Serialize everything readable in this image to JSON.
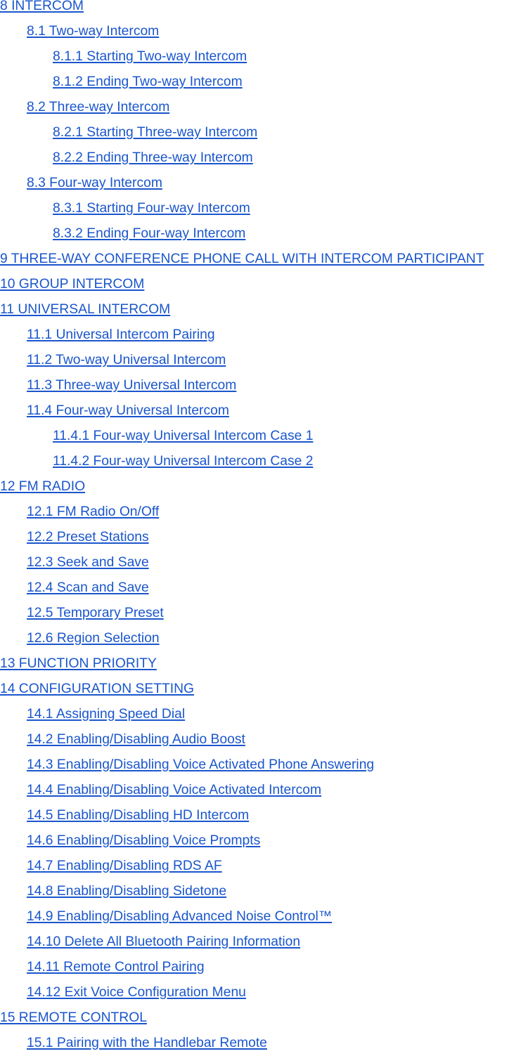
{
  "link_color": "#1a56cc",
  "toc": [
    {
      "level": 1,
      "label": "8 INTERCOM"
    },
    {
      "level": 2,
      "label": "8.1 Two-way Intercom"
    },
    {
      "level": 3,
      "label": "8.1.1 Starting Two-way Intercom"
    },
    {
      "level": 3,
      "label": "8.1.2 Ending Two-way Intercom"
    },
    {
      "level": 2,
      "label": "8.2 Three-way Intercom"
    },
    {
      "level": 3,
      "label": "8.2.1 Starting Three-way Intercom"
    },
    {
      "level": 3,
      "label": "8.2.2 Ending Three-way Intercom"
    },
    {
      "level": 2,
      "label": "8.3 Four-way Intercom"
    },
    {
      "level": 3,
      "label": "8.3.1 Starting Four-way Intercom"
    },
    {
      "level": 3,
      "label": "8.3.2 Ending Four-way Intercom"
    },
    {
      "level": 1,
      "label": "9 THREE-WAY CONFERENCE PHONE CALL WITH INTERCOM PARTICIPANT"
    },
    {
      "level": 1,
      "label": "10 GROUP INTERCOM"
    },
    {
      "level": 1,
      "label": "11 UNIVERSAL INTERCOM"
    },
    {
      "level": 2,
      "label": "11.1 Universal Intercom Pairing"
    },
    {
      "level": 2,
      "label": "11.2 Two-way Universal Intercom"
    },
    {
      "level": 2,
      "label": "11.3 Three-way Universal Intercom"
    },
    {
      "level": 2,
      "label": "11.4 Four-way Universal Intercom"
    },
    {
      "level": 3,
      "label": "11.4.1 Four-way Universal Intercom Case 1"
    },
    {
      "level": 3,
      "label": "11.4.2 Four-way Universal Intercom Case 2"
    },
    {
      "level": 1,
      "label": "12 FM RADIO"
    },
    {
      "level": 2,
      "label": "12.1 FM Radio On/Off"
    },
    {
      "level": 2,
      "label": "12.2 Preset Stations"
    },
    {
      "level": 2,
      "label": "12.3 Seek and Save"
    },
    {
      "level": 2,
      "label": "12.4 Scan and Save"
    },
    {
      "level": 2,
      "label": "12.5 Temporary Preset"
    },
    {
      "level": 2,
      "label": "12.6 Region Selection"
    },
    {
      "level": 1,
      "label": "13 FUNCTION PRIORITY"
    },
    {
      "level": 1,
      "label": "14 CONFIGURATION SETTING"
    },
    {
      "level": 2,
      "label": "14.1 Assigning Speed Dial"
    },
    {
      "level": 2,
      "label": "14.2 Enabling/Disabling Audio Boost"
    },
    {
      "level": 2,
      "label": "14.3 Enabling/Disabling Voice Activated Phone Answering"
    },
    {
      "level": 2,
      "label": "14.4 Enabling/Disabling Voice Activated Intercom"
    },
    {
      "level": 2,
      "label": "14.5 Enabling/Disabling HD Intercom"
    },
    {
      "level": 2,
      "label": "14.6 Enabling/Disabling Voice Prompts"
    },
    {
      "level": 2,
      "label": "14.7 Enabling/Disabling RDS AF"
    },
    {
      "level": 2,
      "label": "14.8 Enabling/Disabling Sidetone"
    },
    {
      "level": 2,
      "label": "14.9 Enabling/Disabling Advanced Noise Control™"
    },
    {
      "level": 2,
      "label": "14.10 Delete All Bluetooth Pairing Information"
    },
    {
      "level": 2,
      "label": "14.11 Remote Control Pairing"
    },
    {
      "level": 2,
      "label": "14.12 Exit Voice Configuration Menu"
    },
    {
      "level": 1,
      "label": "15 REMOTE CONTROL"
    },
    {
      "level": 2,
      "label": "15.1 Pairing with the Handlebar Remote"
    }
  ]
}
